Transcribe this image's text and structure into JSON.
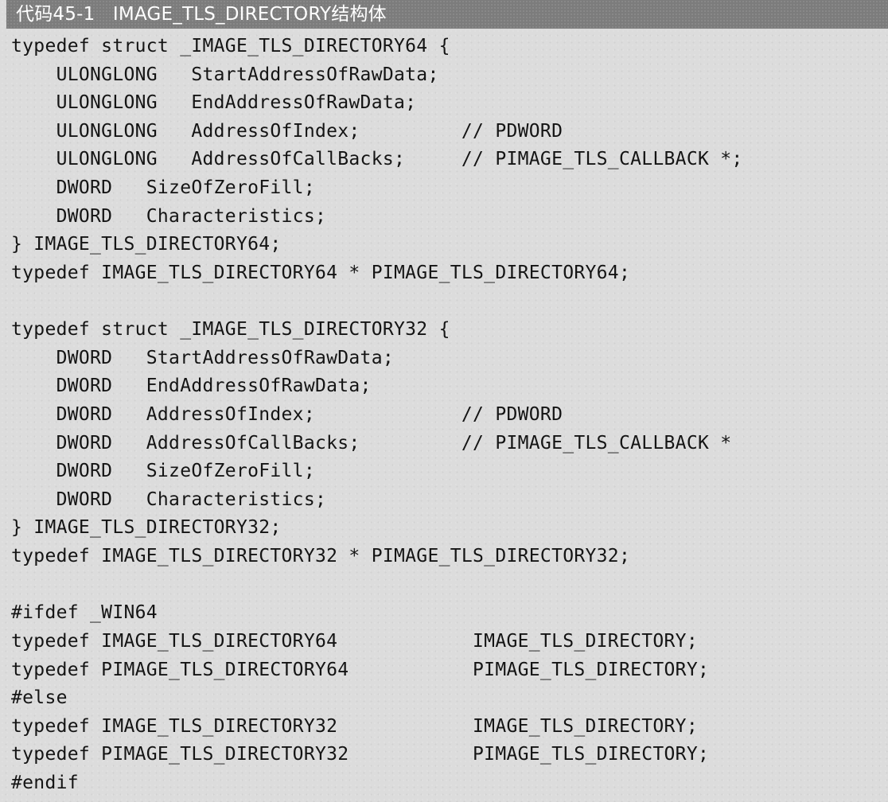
{
  "caption": "代码45-1   IMAGE_TLS_DIRECTORY结构体",
  "code_lines": [
    "typedef struct _IMAGE_TLS_DIRECTORY64 {",
    "    ULONGLONG   StartAddressOfRawData;",
    "    ULONGLONG   EndAddressOfRawData;",
    "    ULONGLONG   AddressOfIndex;         // PDWORD",
    "    ULONGLONG   AddressOfCallBacks;     // PIMAGE_TLS_CALLBACK *;",
    "    DWORD   SizeOfZeroFill;",
    "    DWORD   Characteristics;",
    "} IMAGE_TLS_DIRECTORY64;",
    "typedef IMAGE_TLS_DIRECTORY64 * PIMAGE_TLS_DIRECTORY64;",
    "",
    "typedef struct _IMAGE_TLS_DIRECTORY32 {",
    "    DWORD   StartAddressOfRawData;",
    "    DWORD   EndAddressOfRawData;",
    "    DWORD   AddressOfIndex;             // PDWORD",
    "    DWORD   AddressOfCallBacks;         // PIMAGE_TLS_CALLBACK *",
    "    DWORD   SizeOfZeroFill;",
    "    DWORD   Characteristics;",
    "} IMAGE_TLS_DIRECTORY32;",
    "typedef IMAGE_TLS_DIRECTORY32 * PIMAGE_TLS_DIRECTORY32;",
    "",
    "#ifdef _WIN64",
    "typedef IMAGE_TLS_DIRECTORY64            IMAGE_TLS_DIRECTORY;",
    "typedef PIMAGE_TLS_DIRECTORY64           PIMAGE_TLS_DIRECTORY;",
    "#else",
    "typedef IMAGE_TLS_DIRECTORY32            IMAGE_TLS_DIRECTORY;",
    "typedef PIMAGE_TLS_DIRECTORY32           PIMAGE_TLS_DIRECTORY;",
    "#endif"
  ]
}
